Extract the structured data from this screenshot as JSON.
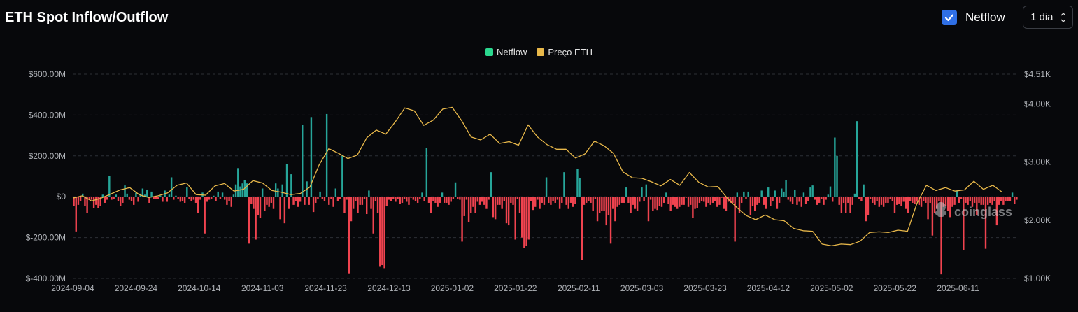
{
  "header": {
    "title": "ETH Spot Inflow/Outflow",
    "netflow_toggle_label": "Netflow",
    "interval_value": "1 dia"
  },
  "watermark": "coinglass",
  "chart_data": {
    "type": "bar+line",
    "legend_placement": "top-center",
    "grid": true,
    "legend": [
      {
        "name": "Netflow",
        "color": "#2bd88f"
      },
      {
        "name": "Preço ETH",
        "color": "#e8b84a"
      }
    ],
    "colors": {
      "inflow": "#26a69a",
      "outflow": "#f0434f",
      "price": "#e8b84a"
    },
    "x_start": "2024-09-04",
    "x_tick_labels": [
      "2024-09-04",
      "2024-09-24",
      "2024-10-14",
      "2024-11-03",
      "2024-11-23",
      "2024-12-13",
      "2025-01-02",
      "2025-01-22",
      "2025-02-11",
      "2025-03-03",
      "2025-03-23",
      "2025-04-12",
      "2025-05-02",
      "2025-05-22",
      "2025-06-11"
    ],
    "y_left": {
      "ylim": [
        -400,
        600
      ],
      "unit": "M USD",
      "tick_values": [
        600,
        400,
        200,
        0,
        -200,
        -400
      ],
      "tick_labels": [
        "$600.00M",
        "$400.00M",
        "$200.00M",
        "$0",
        "$-200.00M",
        "$-400.00M"
      ]
    },
    "y_right": {
      "ylim": [
        1000,
        4510
      ],
      "unit": "USD",
      "tick_values": [
        4510,
        4000,
        3000,
        2000,
        1000
      ],
      "tick_labels": [
        "$4.51K",
        "$4.00K",
        "$3.00K",
        "$2.00K",
        "$1.00K"
      ]
    },
    "series": [
      {
        "name": "Netflow",
        "axis": "left",
        "values": [
          -45,
          -170,
          -40,
          -20,
          15,
          -45,
          -80,
          -10,
          -15,
          -55,
          -40,
          -55,
          -45,
          10,
          -30,
          -15,
          100,
          -15,
          -10,
          10,
          -20,
          -45,
          -30,
          55,
          15,
          -15,
          -20,
          -40,
          20,
          -25,
          15,
          40,
          10,
          35,
          -30,
          25,
          -10,
          -10,
          -10,
          5,
          -25,
          30,
          -25,
          10,
          95,
          -15,
          5,
          -10,
          -25,
          -20,
          -30,
          45,
          -10,
          -20,
          -15,
          -30,
          -80,
          -15,
          20,
          -180,
          -25,
          -15,
          -10,
          5,
          -20,
          25,
          -10,
          20,
          -15,
          -40,
          -20,
          -50,
          10,
          60,
          140,
          50,
          65,
          80,
          65,
          -230,
          -35,
          -60,
          -210,
          -90,
          -105,
          40,
          -70,
          -40,
          -50,
          -30,
          -60,
          65,
          40,
          -110,
          60,
          -130,
          160,
          -60,
          110,
          -40,
          -20,
          -50,
          -25,
          350,
          -40,
          75,
          -40,
          390,
          -75,
          -30,
          -10,
          25,
          -10,
          -20,
          405,
          -40,
          -10,
          -50,
          40,
          -20,
          -10,
          200,
          -80,
          -15,
          -375,
          -120,
          -60,
          -20,
          -80,
          -40,
          -40,
          -10,
          -85,
          30,
          -60,
          -180,
          -20,
          -80,
          -340,
          -335,
          -350,
          -45,
          -15,
          -20,
          -10,
          -25,
          -10,
          -35,
          -30,
          -10,
          -25,
          -40,
          -5,
          -15,
          -20,
          -30,
          -10,
          20,
          -20,
          240,
          -30,
          -80,
          -20,
          -30,
          -50,
          -30,
          20,
          -30,
          -30,
          -40,
          -25,
          -10,
          70,
          -10,
          -15,
          -220,
          -95,
          -15,
          -125,
          -80,
          -50,
          -80,
          -25,
          -40,
          -25,
          -40,
          -60,
          -15,
          120,
          -100,
          -110,
          -40,
          -40,
          -60,
          -20,
          -130,
          -140,
          -30,
          -40,
          -210,
          -10,
          -80,
          -200,
          -250,
          -240,
          -210,
          -20,
          -65,
          -50,
          -15,
          -60,
          -30,
          -40,
          95,
          -30,
          -40,
          -20,
          -30,
          -15,
          -60,
          -30,
          120,
          -40,
          -60,
          -30,
          -50,
          -35,
          135,
          90,
          -310,
          -40,
          -30,
          -20,
          -30,
          -70,
          -10,
          -120,
          -80,
          -70,
          -70,
          -140,
          -90,
          -230,
          -60,
          -120,
          -50,
          -40,
          -30,
          -30,
          45,
          -30,
          -80,
          -40,
          -60,
          -70,
          -25,
          45,
          -20,
          60,
          -120,
          -15,
          -70,
          -60,
          -65,
          -45,
          -50,
          -30,
          20,
          -35,
          -70,
          -40,
          -50,
          -60,
          -50,
          -40,
          -40,
          -5,
          -50,
          -40,
          -105,
          -60,
          -55,
          -30,
          -20,
          -25,
          -50,
          -30,
          -40,
          -30,
          -20,
          -50,
          -40,
          -5,
          -60,
          -70,
          -25,
          -30,
          -30,
          -220,
          20,
          -80,
          -30,
          25,
          -10,
          25,
          -90,
          -45,
          -70,
          -40,
          -30,
          30,
          -40,
          -60,
          45,
          -45,
          -20,
          30,
          -60,
          -30,
          40,
          25,
          80,
          -15,
          -25,
          -35,
          35,
          -40,
          -25,
          -50,
          20,
          -35,
          -20,
          45,
          55,
          -15,
          -40,
          -30,
          -10,
          -40,
          -15,
          10,
          50,
          -25,
          290,
          200,
          -40,
          -80,
          -30,
          -80,
          -30,
          -80,
          -40,
          15,
          370,
          -10,
          -20,
          60,
          -120,
          -90,
          -10,
          -30,
          -40,
          -20,
          -50,
          -40,
          -50,
          -30,
          -30,
          -10,
          -20,
          -80,
          -40,
          -35,
          -45,
          -25,
          -60,
          -80,
          -20,
          -30,
          -35,
          -25,
          -40,
          -50,
          -20,
          -30,
          -110,
          -30,
          -190,
          -80,
          -60,
          -20,
          -380,
          -50,
          -45,
          -70,
          -100,
          -50,
          -40,
          30,
          -30,
          -10,
          -260,
          -30,
          -40,
          -20,
          -50,
          -30,
          -90,
          -30,
          -40,
          -40,
          -255,
          -40,
          -30,
          -40,
          -20,
          -140,
          -40,
          -20,
          -40,
          -20,
          -20,
          -20,
          20,
          -35,
          -15
        ]
      },
      {
        "name": "Preço ETH",
        "axis": "right",
        "x_days": [
          0,
          3,
          6,
          9,
          12,
          15,
          18,
          21,
          24,
          27,
          30,
          33,
          36,
          39,
          42,
          45,
          48,
          51,
          54,
          57,
          60,
          63,
          66,
          69,
          72,
          75,
          78,
          81,
          84,
          87,
          90,
          93,
          96,
          99,
          102,
          105,
          108,
          111,
          114,
          117,
          120,
          123,
          126,
          129,
          132,
          135,
          138,
          141,
          144,
          147,
          150,
          153,
          156,
          159,
          162,
          165,
          168,
          171,
          174,
          177,
          180,
          183,
          186,
          189,
          192,
          195,
          198,
          201,
          204,
          207,
          210,
          213,
          216,
          219,
          222,
          225,
          228,
          231,
          234,
          237,
          240,
          243,
          246,
          249,
          252,
          255,
          258,
          261,
          264,
          267,
          270,
          273,
          276,
          279,
          282,
          285,
          288,
          291,
          294
        ],
        "values": [
          2380,
          2420,
          2330,
          2380,
          2450,
          2520,
          2560,
          2440,
          2390,
          2420,
          2470,
          2600,
          2640,
          2440,
          2430,
          2590,
          2630,
          2500,
          2530,
          2680,
          2640,
          2510,
          2480,
          2440,
          2460,
          2570,
          2960,
          3230,
          3150,
          3060,
          3120,
          3420,
          3550,
          3480,
          3690,
          3930,
          3880,
          3630,
          3720,
          3910,
          3940,
          3710,
          3430,
          3380,
          3480,
          3320,
          3350,
          3290,
          3640,
          3430,
          3300,
          3220,
          3220,
          3070,
          3140,
          3360,
          3280,
          3150,
          2830,
          2730,
          2720,
          2660,
          2590,
          2700,
          2600,
          2820,
          2650,
          2570,
          2580,
          2380,
          2220,
          2080,
          2010,
          2090,
          2010,
          1990,
          1860,
          1820,
          1810,
          1590,
          1560,
          1590,
          1580,
          1640,
          1790,
          1800,
          1790,
          1830,
          1810,
          2290,
          2600,
          2510,
          2560,
          2500,
          2520,
          2670,
          2530,
          2600,
          2480,
          2500,
          2530
        ]
      }
    ]
  }
}
